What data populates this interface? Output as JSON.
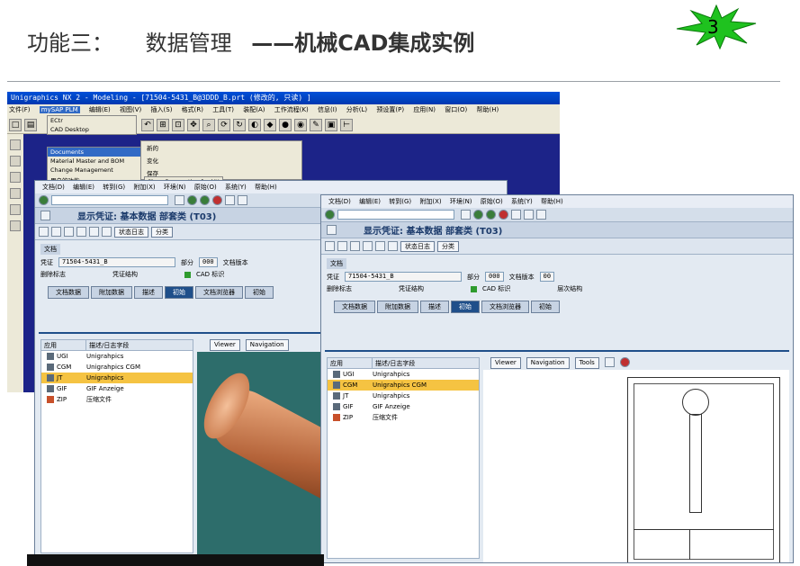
{
  "slide": {
    "title_part1": "功能三：",
    "title_part2": "数据管理",
    "title_part3": "——机械CAD集成实例",
    "page_number": "3"
  },
  "nx_window": {
    "title": "Unigraphics NX 2 - Modeling - [71504-5431_B@3DDD_B.prt (修改的, 只读) ]",
    "menus": [
      "文件(F)",
      "mySAP PLM",
      "编辑(E)",
      "视图(V)",
      "插入(S)",
      "格式(R)",
      "工具(T)",
      "装配(A)",
      "工作流程(K)",
      "信息(I)",
      "分析(L)",
      "预设置(P)",
      "应用(N)",
      "窗口(O)",
      "帮助(H)"
    ],
    "menu_selected": "mySAP PLM",
    "dropdown": [
      "ECtr",
      "CAD Desktop"
    ],
    "submenu": [
      "Documents",
      "Material Master and BOM",
      "Change Management",
      "用户的功能"
    ],
    "submenu_highlight": "Documents",
    "actions": [
      "新的",
      "变化",
      "保存"
    ],
    "hint": "Show Perspective for NX"
  },
  "sap_common": {
    "menus": [
      "文档(D)",
      "编辑(E)",
      "转到(G)",
      "附加(X)",
      "环境(N)",
      "原始(O)",
      "系统(Y)",
      "帮助(H)"
    ],
    "screen_title": "显示凭证: 基本数据 部套类 (T03)",
    "app_buttons": [
      "状态日志",
      "分类"
    ],
    "doc_label": "文档",
    "doc_field_label": "凭证",
    "doc_number": "71504-5431_B",
    "part_label": "部分",
    "part_value": "000",
    "version_label": "文档版本",
    "version_value": "00",
    "checks": [
      "删除标志",
      "凭证结构",
      "CAD 标识",
      "层次结构"
    ],
    "tabs": [
      "文档数据",
      "附加数据",
      "描述",
      "初始",
      "文档浏览器",
      "初始"
    ],
    "active_tab": "初始",
    "tree_headers": [
      "应用",
      "描述/日志字段"
    ],
    "tree_rows": [
      {
        "app": "UGI",
        "desc": "Unigrahpics"
      },
      {
        "app": "CGM",
        "desc": "Unigrahpics CGM"
      },
      {
        "app": "JT",
        "desc": "Unigrahpics"
      },
      {
        "app": "GIF",
        "desc": "GIF Anzeige"
      },
      {
        "app": "ZIP",
        "desc": "压缩文件"
      }
    ],
    "viewer_buttons": [
      "Viewer",
      "Navigation",
      "Tools"
    ]
  },
  "sap1": {
    "highlight_row": "JT"
  },
  "sap2": {
    "highlight_row": "CGM"
  },
  "colors": {
    "sap_header": "#1f4f8a",
    "highlight": "#f5c342",
    "nx_title": "#0050d8"
  }
}
